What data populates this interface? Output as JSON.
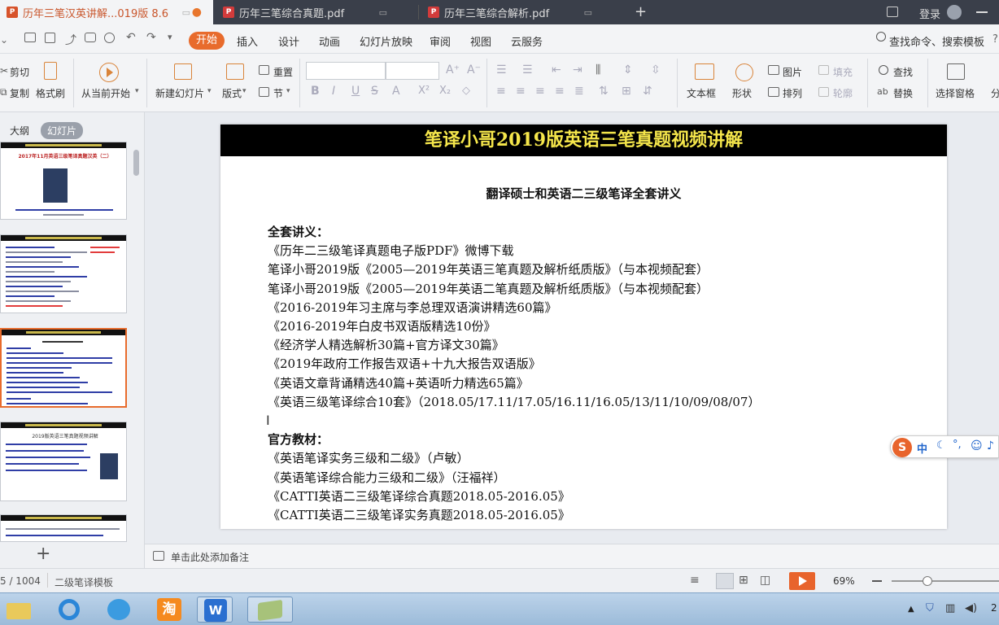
{
  "tabs": [
    {
      "label": "历年三笔汉英讲解...019版 8.6",
      "active": true
    },
    {
      "label": "历年三笔综合真题.pdf",
      "active": false
    },
    {
      "label": "历年三笔综合解析.pdf",
      "active": false
    }
  ],
  "titlebar": {
    "new_tab": "+",
    "login": "登录"
  },
  "menu": {
    "items": [
      "开始",
      "插入",
      "设计",
      "动画",
      "幻灯片放映",
      "审阅",
      "视图",
      "云服务"
    ],
    "search": "查找命令、搜索模板"
  },
  "ribbon": {
    "cut": "剪切",
    "copy": "复制",
    "format_painter": "格式刷",
    "play_from_current": "从当前开始",
    "new_slide": "新建幻灯片",
    "layout": "版式",
    "reset": "重置",
    "section": "节",
    "textbox": "文本框",
    "shape": "形状",
    "picture": "图片",
    "fill": "填充",
    "arrange": "排列",
    "outline": "轮廓",
    "find": "查找",
    "replace": "替换",
    "selection_pane": "选择窗格",
    "split": "分"
  },
  "left_panel": {
    "tab_outline": "大纲",
    "tab_slides": "幻灯片",
    "add": "+"
  },
  "thumbnails": [
    {
      "title": "2017年11月英语三级笔译真题汉英（二）"
    },
    {
      "title": ""
    },
    {
      "title": ""
    },
    {
      "title": "2019版英语三笔真题视频讲解"
    },
    {
      "title": ""
    }
  ],
  "slide": {
    "banner": "笔译小哥2019版英语三笔真题视频讲解",
    "subtitle": "翻译硕士和英语二三级笔译全套讲义",
    "lines": [
      {
        "text": "全套讲义：",
        "bold": true
      },
      {
        "text": "《历年二三级笔译真题电子版PDF》微博下载",
        "bold": false
      },
      {
        "text": "笔译小哥2019版《2005—2019年英语三笔真题及解析纸质版》（与本视频配套）",
        "bold": false
      },
      {
        "text": "笔译小哥2019版《2005—2019年英语二笔真题及解析纸质版》（与本视频配套）",
        "bold": false
      },
      {
        "text": "《2016-2019年习主席与李总理双语演讲精选60篇》",
        "bold": false
      },
      {
        "text": "《2016-2019年白皮书双语版精选10份》",
        "bold": false
      },
      {
        "text": "《经济学人精选解析30篇+官方译文30篇》",
        "bold": false
      },
      {
        "text": "《2019年政府工作报告双语+十九大报告双语版》",
        "bold": false
      },
      {
        "text": "《英语文章背诵精选40篇+英语听力精选65篇》",
        "bold": false
      },
      {
        "text": "《英语三级笔译综合10套》（2018.05/17.11/17.05/16.11/16.05/13/11/10/09/08/07）",
        "bold": false
      },
      {
        "text": "",
        "bold": false
      },
      {
        "text": "官方教材：",
        "bold": true
      },
      {
        "text": "《英语笔译实务三级和二级》（卢敏）",
        "bold": false
      },
      {
        "text": "《英语笔译综合能力三级和二级》（汪福祥）",
        "bold": false
      },
      {
        "text": "《CATTI英语二三级笔译综合真题2018.05-2016.05》",
        "bold": false
      },
      {
        "text": "《CATTI英语二三级笔译实务真题2018.05-2016.05》",
        "bold": false
      }
    ]
  },
  "ime": {
    "label": "中"
  },
  "notes": {
    "placeholder": "单击此处添加备注"
  },
  "status": {
    "slide_count": "5 / 1004",
    "template": "二级笔译模板",
    "zoom": "69%"
  },
  "taskbar": {
    "clock": "2"
  }
}
